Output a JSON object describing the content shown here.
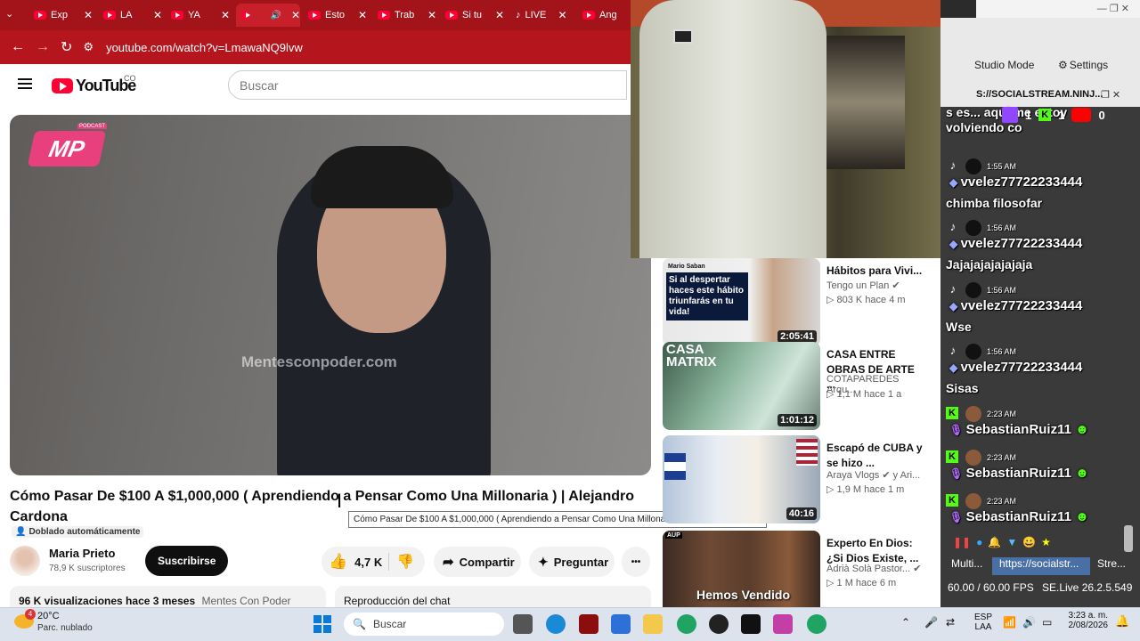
{
  "browser": {
    "tabs": [
      {
        "label": "Exp",
        "icon": "youtube-icon"
      },
      {
        "label": "LA",
        "icon": "youtube-icon"
      },
      {
        "label": "YA",
        "icon": "youtube-icon"
      },
      {
        "label": "",
        "icon": "youtube-icon",
        "active": true
      },
      {
        "label": "Esto",
        "icon": "youtube-icon"
      },
      {
        "label": "Trab",
        "icon": "youtube-icon"
      },
      {
        "label": "Si tu",
        "icon": "youtube-icon"
      },
      {
        "label": "LIVE",
        "icon": "tiktok-icon"
      },
      {
        "label": "Ang",
        "icon": "youtube-icon"
      }
    ],
    "url": "youtube.com/watch?v=LmawaNQ9lvw"
  },
  "youtube": {
    "logo_text": "YouTube",
    "region": "CO",
    "search_placeholder": "Buscar",
    "video_watermark": "Mentesconpoder.com",
    "video_brand": "PODCAST",
    "title": "Cómo Pasar De $100 A $1,000,000 ( Aprendiendo a Pensar Como Una Millonaria ) | Alejandro Cardona",
    "tooltip": "Cómo Pasar De $100 A $1,000,000 ( Aprendiendo a Pensar Como Una Millonaria ) | Alejandro Cardona",
    "dubbed": "Doblado automáticamente",
    "channel": "Maria Prieto",
    "subscribers": "78,9 K suscriptores",
    "subscribe_label": "Suscribirse",
    "likes": "4,7 K",
    "share_label": "Compartir",
    "ask_label": "Preguntar",
    "more": "•••",
    "views": "96 K visualizaciones  hace 3 meses",
    "views_tag": "Mentes Con Poder",
    "chat_replay": "Reproducción del chat"
  },
  "recommendations": [
    {
      "title": "Hábitos para Vivi...",
      "channel": "Tengo un Plan",
      "verified": true,
      "stats": "▷ 803 K  hace 4 m",
      "duration": "2:05:41",
      "thumb_text": "Si al despertar haces este hábito triunfarás en tu vida!",
      "thumb_name": "Mario Saban"
    },
    {
      "title": "CASA ENTRE OBRAS DE ARTE ...",
      "channel": "COTAPAREDES Arqu...",
      "verified": false,
      "stats": "▷ 1,1 M  hace 1 a",
      "duration": "1:01:12",
      "thumb_text": "CASA MATRIX",
      "thumb_name": ""
    },
    {
      "title": "Escapó de CUBA y se hizo ...",
      "channel": "Araya Vlogs",
      "verified": true,
      "channel_suffix": "y Ari...",
      "stats": "▷ 1,9 M  hace 1 m",
      "duration": "40:16",
      "thumb_text": "",
      "thumb_name": ""
    },
    {
      "title": "Experto En Dios: ¿Si Dios Existe, ...",
      "channel": "Adrià Solà Pastor...",
      "verified": true,
      "stats": "▷ 1 M  hace 6 m",
      "duration": "",
      "thumb_text": "Hemos Vendido",
      "thumb_name": "AUP"
    }
  ],
  "socialstream": {
    "studio_mode": "Studio Mode",
    "settings": "Settings",
    "url": "S://SOCIALSTREAM.NINJ...",
    "top_msg": "s es... aqui me estoy volviendo co",
    "platform_counts": [
      {
        "platform": "twitch",
        "count": "1"
      },
      {
        "platform": "kick",
        "count": "1"
      },
      {
        "platform": "youtube",
        "count": "0"
      }
    ],
    "messages": [
      {
        "platform": "tiktok",
        "time": "1:55 AM",
        "user": "vvelez77722233444",
        "text": "chimba filosofar"
      },
      {
        "platform": "tiktok",
        "time": "1:56 AM",
        "user": "vvelez77722233444",
        "text": "Jajajajajajajaja"
      },
      {
        "platform": "tiktok",
        "time": "1:56 AM",
        "user": "vvelez77722233444",
        "text": "Wse"
      },
      {
        "platform": "tiktok",
        "time": "1:56 AM",
        "user": "vvelez77722233444",
        "text": "Sisas"
      },
      {
        "platform": "kick",
        "time": "2:23 AM",
        "user": "SebastianRuiz11",
        "text": ""
      },
      {
        "platform": "kick",
        "time": "2:23 AM",
        "user": "SebastianRuiz11",
        "text": ""
      },
      {
        "platform": "kick",
        "time": "2:23 AM",
        "user": "SebastianRuiz11",
        "text": ""
      }
    ],
    "bottom_tabs": [
      "Multi...",
      "https://socialstr...",
      "Stre..."
    ],
    "fps": "60.00 / 60.00 FPS",
    "version": "SE.Live 26.2.5.549"
  },
  "taskbar": {
    "weather_temp": "20°C",
    "weather_desc": "Parc. nublado",
    "weather_badge": "4",
    "search": "Buscar",
    "lang": "ESP",
    "lang2": "LAA",
    "time": "3:23 a. m.",
    "date": "2/08/2026"
  },
  "colors": {
    "browser_red": "#a3131a",
    "youtube_red": "#ff0033",
    "kick_green": "#53fc18"
  }
}
